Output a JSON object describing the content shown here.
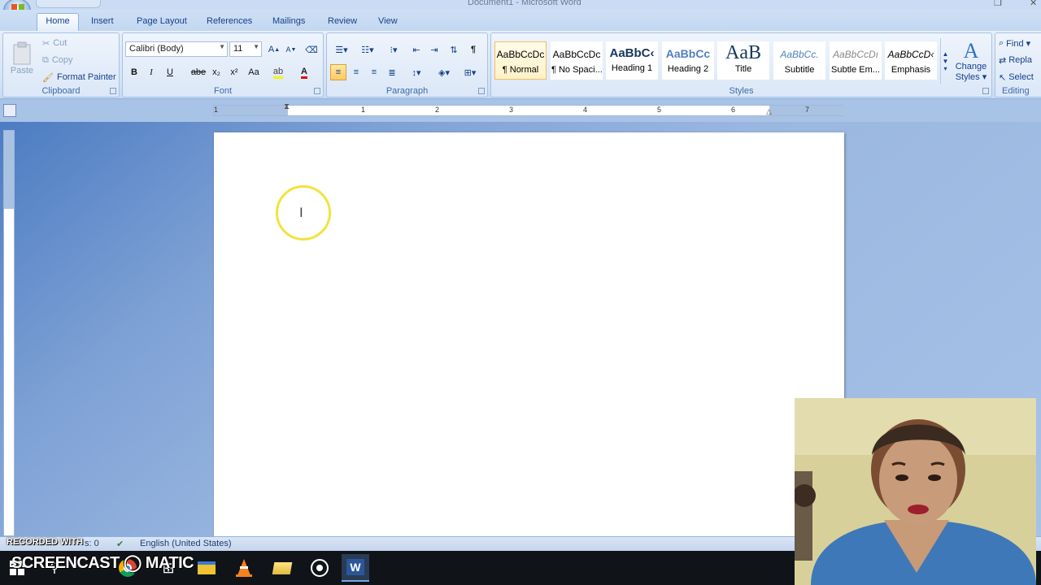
{
  "window": {
    "title": "Document1 - Microsoft Word"
  },
  "tabs": [
    "Home",
    "Insert",
    "Page Layout",
    "References",
    "Mailings",
    "Review",
    "View"
  ],
  "active_tab": "Home",
  "clipboard": {
    "paste": "Paste",
    "cut": "Cut",
    "copy": "Copy",
    "format_painter": "Format Painter",
    "label": "Clipboard"
  },
  "font": {
    "name": "Calibri (Body)",
    "size": "11",
    "bold": "B",
    "italic": "I",
    "underline": "U",
    "strike": "abe",
    "subscript": "x₂",
    "superscript": "x²",
    "case": "Aa",
    "label": "Font"
  },
  "paragraph": {
    "label": "Paragraph",
    "pilcrow": "¶"
  },
  "styles": {
    "label": "Styles",
    "items": [
      {
        "preview": "AaBbCcDc",
        "name": "¶ Normal"
      },
      {
        "preview": "AaBbCcDc",
        "name": "¶ No Spaci..."
      },
      {
        "preview": "AaBbC‹",
        "name": "Heading 1"
      },
      {
        "preview": "AaBbCc",
        "name": "Heading 2"
      },
      {
        "preview": "AaB",
        "name": "Title"
      },
      {
        "preview": "AaBbCc.",
        "name": "Subtitle"
      },
      {
        "preview": "AaBbCcDı",
        "name": "Subtle Em..."
      },
      {
        "preview": "AaBbCcD‹",
        "name": "Emphasis"
      }
    ],
    "change_styles_1": "Change",
    "change_styles_2": "Styles ▾"
  },
  "editing": {
    "find": "Find ▾",
    "replace": "Repla",
    "select": "Select",
    "label": "Editing"
  },
  "ruler": {
    "numbers": [
      "1",
      "1",
      "2",
      "3",
      "4",
      "5",
      "6",
      "7"
    ]
  },
  "status": {
    "words": "s: 0",
    "language": "English (United States)"
  },
  "watermark": {
    "recorded": "RECORDED WITH",
    "brand": "SCREENCAST ◯ MATIC"
  },
  "colors": {
    "accent": "#15428b",
    "ribbon": "#dbe7f7",
    "highlight": "#f2e33d"
  }
}
